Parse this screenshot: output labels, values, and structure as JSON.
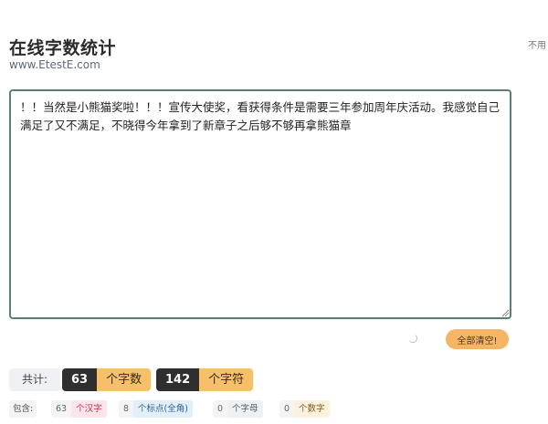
{
  "header": {
    "title": "在线字数统计",
    "subtitle": "www.EtestE.com",
    "side_note": "不用"
  },
  "editor": {
    "text": "！！当然是小熊猫奖啦！！！宣传大使奖，看获得条件是需要三年参加周年庆活动。我感觉自己满足了又不满足，不晓得今年拿到了新章子之后够不够再拿熊猫章"
  },
  "actions": {
    "clear_label": "全部清空!"
  },
  "stats": {
    "total_label": "共计:",
    "chars_value": "63",
    "chars_label": "个字数",
    "symbols_value": "142",
    "symbols_label": "个字符"
  },
  "details": {
    "contains_label": "包含:",
    "han_value": "63",
    "han_label": "个汉字",
    "punct_value": "8",
    "punct_label": "个标点(全角)",
    "letter_value": "0",
    "letter_label": "个字母",
    "digit_value": "0",
    "digit_label": "个数字"
  }
}
